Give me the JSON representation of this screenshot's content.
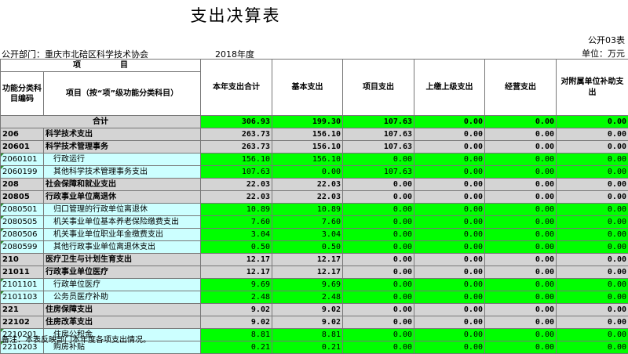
{
  "title": "支出决算表",
  "form_no": "公开03表",
  "unit": "单位：万元",
  "department": "公开部门：重庆市北碚区科学技术协会",
  "year": "2018年度",
  "headers": {
    "item_group": "项　　　　　目",
    "code": "功能分类科目编码",
    "name": "项目（按“项”级功能分类科目）",
    "total": "本年支出合计",
    "basic": "基本支出",
    "project": "项目支出",
    "upper": "上缴上级支出",
    "business": "经营支出",
    "subsidy": "对附属单位补助支出"
  },
  "total_row": {
    "label": "合计",
    "values": [
      "306.93",
      "199.30",
      "107.63",
      "0.00",
      "0.00",
      "0.00"
    ]
  },
  "rows": [
    {
      "level": "l1",
      "code": "206",
      "name": "科学技术支出",
      "values": [
        "263.73",
        "156.10",
        "107.63",
        "0.00",
        "0.00",
        "0.00"
      ]
    },
    {
      "level": "l2",
      "code": "20601",
      "name": "科学技术管理事务",
      "values": [
        "263.73",
        "156.10",
        "107.63",
        "0.00",
        "0.00",
        "0.00"
      ]
    },
    {
      "level": "l3",
      "code": "2060101",
      "name": "行政运行",
      "values": [
        "156.10",
        "156.10",
        "0.00",
        "0.00",
        "0.00",
        "0.00"
      ]
    },
    {
      "level": "l3",
      "code": "2060199",
      "name": "其他科学技术管理事务支出",
      "values": [
        "107.63",
        "0.00",
        "107.63",
        "0.00",
        "0.00",
        "0.00"
      ]
    },
    {
      "level": "l1",
      "code": "208",
      "name": "社会保障和就业支出",
      "values": [
        "22.03",
        "22.03",
        "0.00",
        "0.00",
        "0.00",
        "0.00"
      ]
    },
    {
      "level": "l2",
      "code": "20805",
      "name": "行政事业单位离退休",
      "values": [
        "22.03",
        "22.03",
        "0.00",
        "0.00",
        "0.00",
        "0.00"
      ]
    },
    {
      "level": "l3",
      "code": "2080501",
      "name": "归口管理的行政单位离退休",
      "values": [
        "10.89",
        "10.89",
        "0.00",
        "0.00",
        "0.00",
        "0.00"
      ]
    },
    {
      "level": "l3",
      "code": "2080505",
      "name": "机关事业单位基本养老保险缴费支出",
      "values": [
        "7.60",
        "7.60",
        "0.00",
        "0.00",
        "0.00",
        "0.00"
      ]
    },
    {
      "level": "l3",
      "code": "2080506",
      "name": "机关事业单位职业年金缴费支出",
      "values": [
        "3.04",
        "3.04",
        "0.00",
        "0.00",
        "0.00",
        "0.00"
      ]
    },
    {
      "level": "l3",
      "code": "2080599",
      "name": "其他行政事业单位离退休支出",
      "values": [
        "0.50",
        "0.50",
        "0.00",
        "0.00",
        "0.00",
        "0.00"
      ]
    },
    {
      "level": "l1",
      "code": "210",
      "name": "医疗卫生与计划生育支出",
      "values": [
        "12.17",
        "12.17",
        "0.00",
        "0.00",
        "0.00",
        "0.00"
      ]
    },
    {
      "level": "l2",
      "code": "21011",
      "name": "行政事业单位医疗",
      "values": [
        "12.17",
        "12.17",
        "0.00",
        "0.00",
        "0.00",
        "0.00"
      ]
    },
    {
      "level": "l3",
      "code": "2101101",
      "name": "行政单位医疗",
      "values": [
        "9.69",
        "9.69",
        "0.00",
        "0.00",
        "0.00",
        "0.00"
      ]
    },
    {
      "level": "l3",
      "code": "2101103",
      "name": "公务员医疗补助",
      "values": [
        "2.48",
        "2.48",
        "0.00",
        "0.00",
        "0.00",
        "0.00"
      ]
    },
    {
      "level": "l1",
      "code": "221",
      "name": "住房保障支出",
      "values": [
        "9.02",
        "9.02",
        "0.00",
        "0.00",
        "0.00",
        "0.00"
      ]
    },
    {
      "level": "l2",
      "code": "22102",
      "name": "住房改革支出",
      "values": [
        "9.02",
        "9.02",
        "0.00",
        "0.00",
        "0.00",
        "0.00"
      ]
    },
    {
      "level": "l3",
      "code": "2210201",
      "name": "住房公积金",
      "values": [
        "8.81",
        "8.81",
        "0.00",
        "0.00",
        "0.00",
        "0.00"
      ]
    },
    {
      "level": "l3",
      "code": "2210203",
      "name": "购房补贴",
      "values": [
        "0.21",
        "0.21",
        "0.00",
        "0.00",
        "0.00",
        "0.00"
      ]
    }
  ],
  "note": "备注：本表反映部门本年度各项支出情况。"
}
